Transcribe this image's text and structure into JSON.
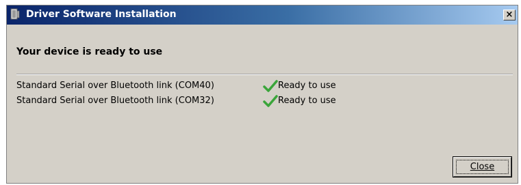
{
  "window": {
    "title": "Driver Software Installation",
    "close_glyph": "×"
  },
  "main": {
    "heading": "Your device is ready to use",
    "devices": [
      {
        "name": "Standard Serial over Bluetooth link (COM40)",
        "status": "Ready to use",
        "status_icon": "checkmark-icon"
      },
      {
        "name": "Standard Serial over Bluetooth link (COM32)",
        "status": "Ready to use",
        "status_icon": "checkmark-icon"
      }
    ]
  },
  "buttons": {
    "close_label": "Close"
  },
  "colors": {
    "titlebar_start": "#0a246a",
    "titlebar_end": "#a6caf0",
    "dialog_bg": "#d4d0c8",
    "check_green": "#3aa53a"
  }
}
